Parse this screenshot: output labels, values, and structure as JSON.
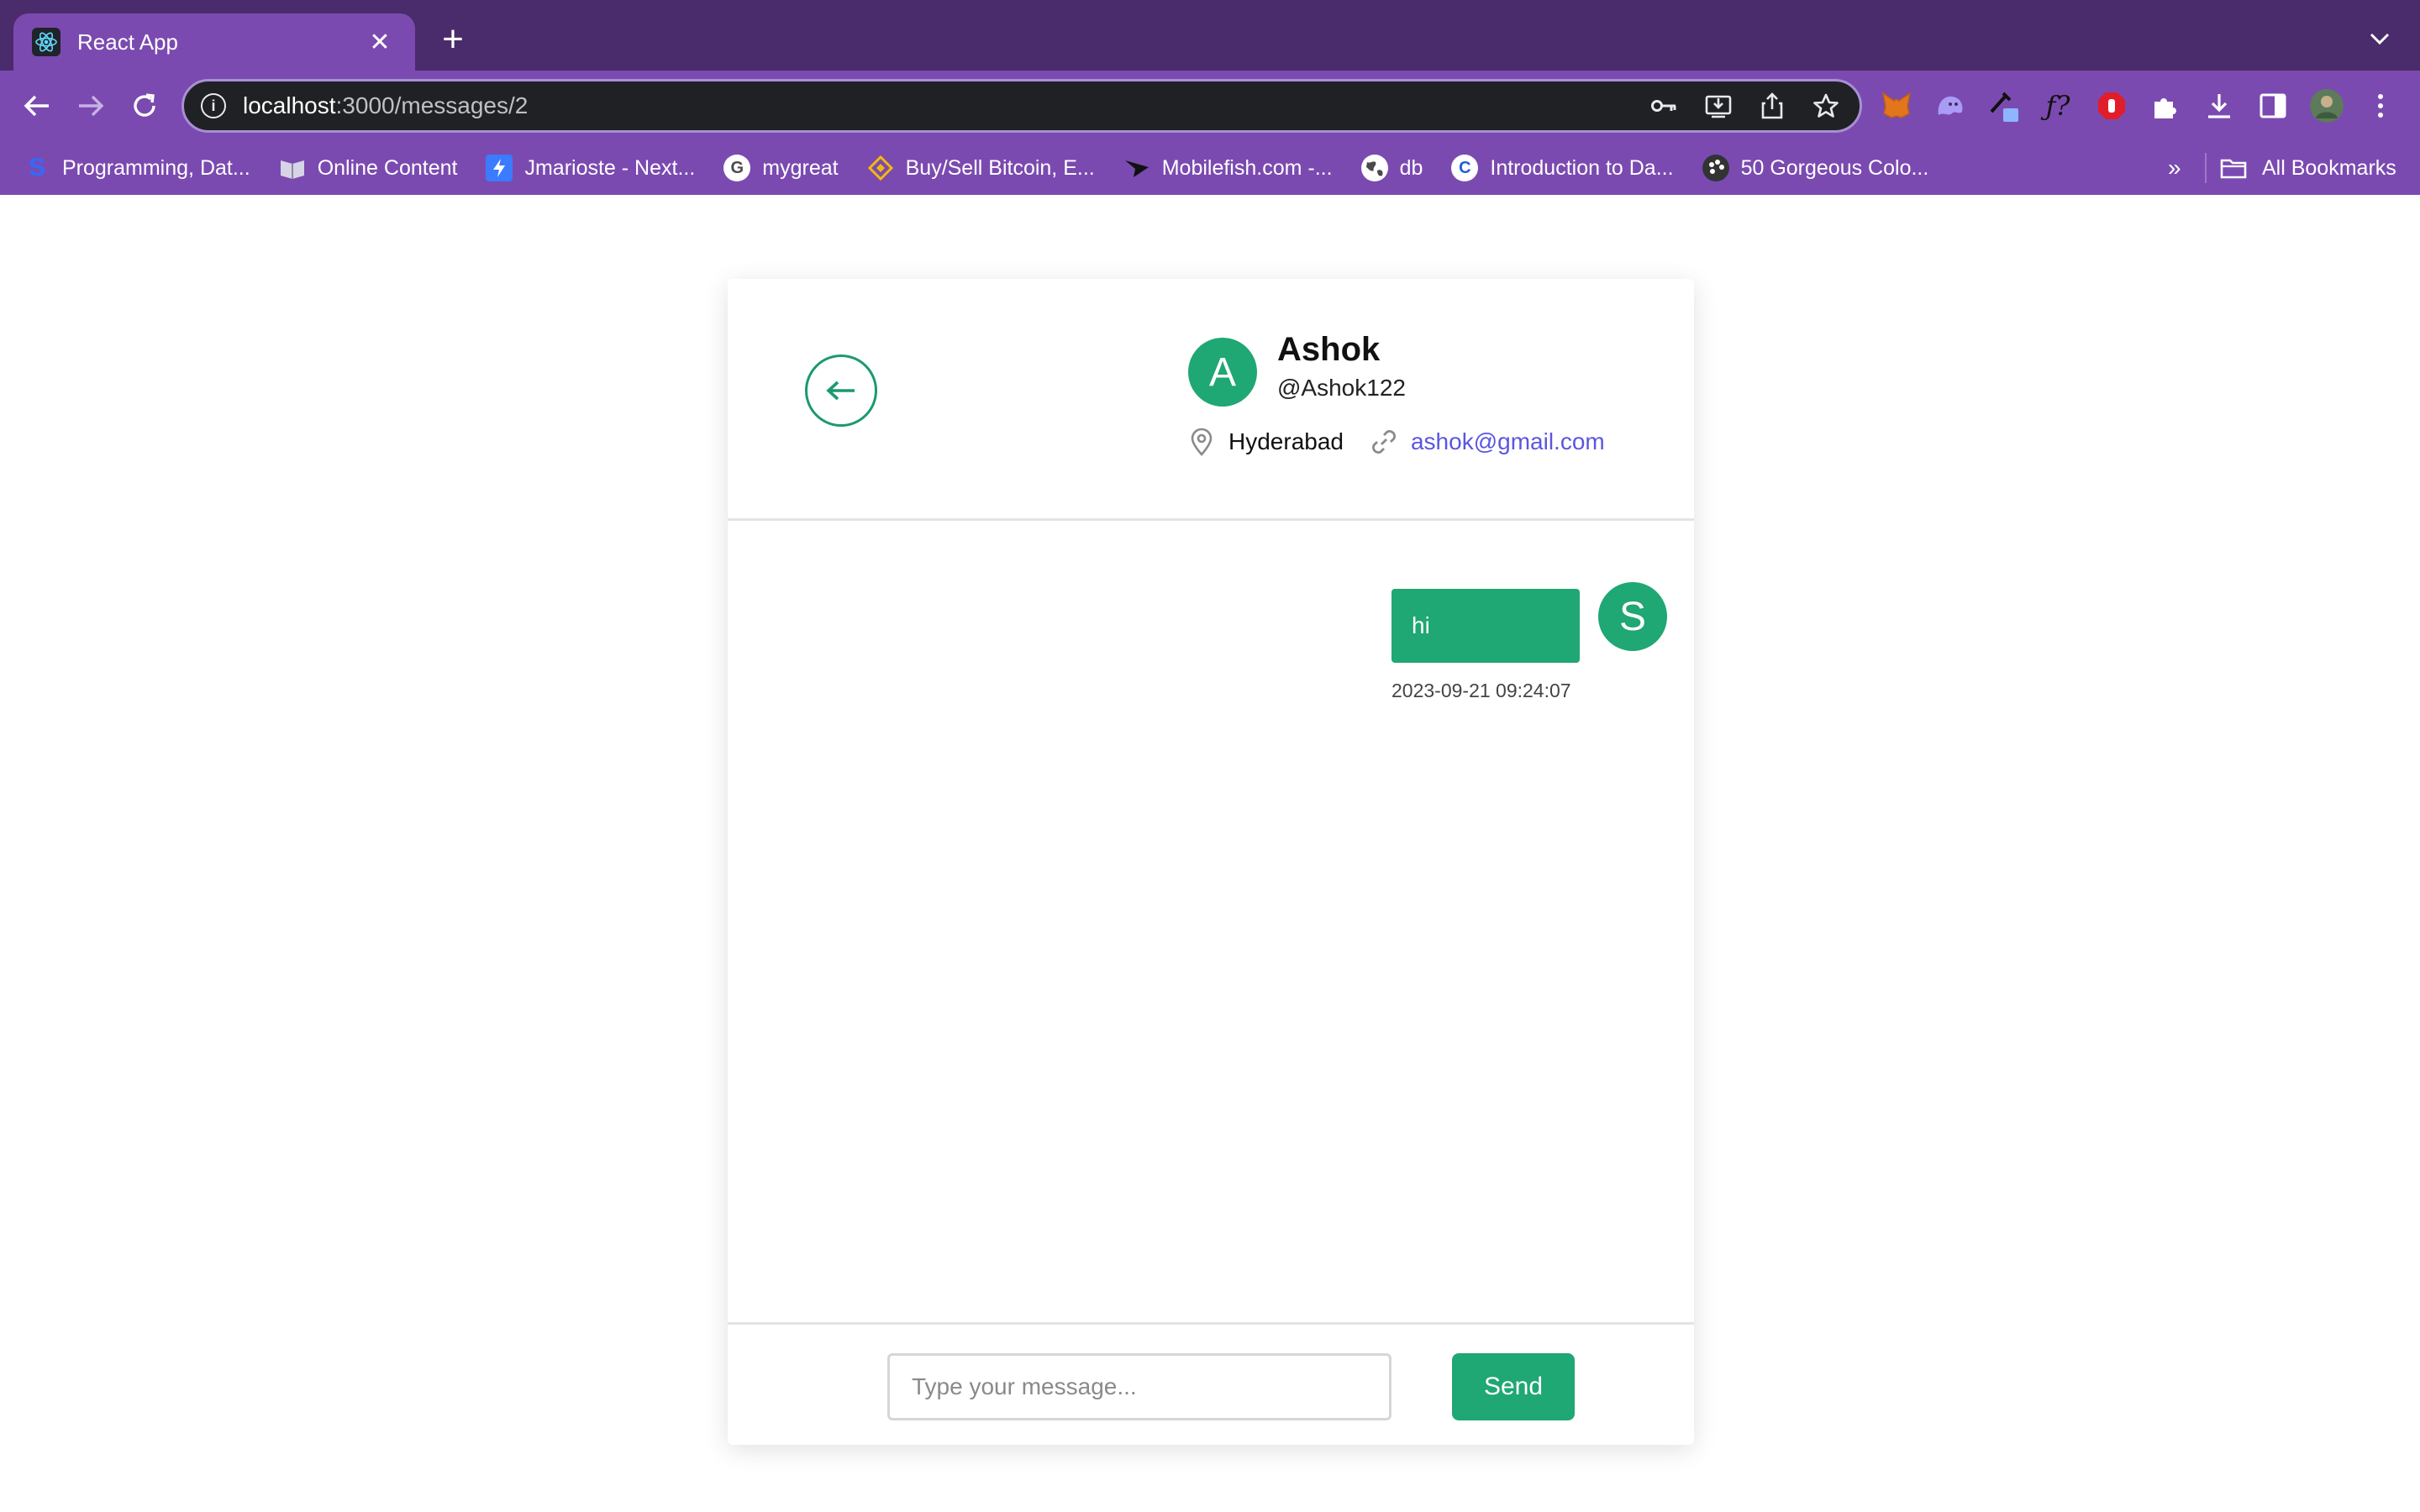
{
  "browser": {
    "tab_title": "React App",
    "tab_close": "✕",
    "new_tab": "+",
    "url_host": "localhost",
    "url_path": ":3000/messages/2",
    "bookmarks": [
      {
        "label": "Programming, Dat...",
        "icon": "s-logo-icon",
        "color": "#2f6bff"
      },
      {
        "label": "Online Content",
        "icon": "book-icon",
        "color": "#c9c9d9"
      },
      {
        "label": "Jmarioste - Next...",
        "icon": "bolt-icon",
        "color": "#3a7bff"
      },
      {
        "label": "mygreat",
        "icon": "google-icon",
        "color": "#ffffff"
      },
      {
        "label": "Buy/Sell Bitcoin, E...",
        "icon": "binance-icon",
        "color": "#f0b90b"
      },
      {
        "label": "Mobilefish.com -...",
        "icon": "fish-icon",
        "color": "#111111"
      },
      {
        "label": "db",
        "icon": "globe-icon",
        "color": "#ffffff"
      },
      {
        "label": "Introduction to Da...",
        "icon": "c-logo-icon",
        "color": "#1f5fd6"
      },
      {
        "label": "50 Gorgeous Colo...",
        "icon": "palette-icon",
        "color": "#333333"
      }
    ],
    "bookmarks_more": "»",
    "all_bookmarks": "All Bookmarks"
  },
  "chat": {
    "contact": {
      "initial": "A",
      "name": "Ashok",
      "handle": "@Ashok122",
      "location": "Hyderabad",
      "email": "ashok@gmail.com"
    },
    "messages": [
      {
        "text": "hi",
        "timestamp": "2023-09-21 09:24:07",
        "sender_initial": "S"
      }
    ],
    "composer": {
      "placeholder": "Type your message...",
      "send_label": "Send"
    }
  },
  "colors": {
    "accent": "#1fa774",
    "chrome": "#7b4ab0",
    "link": "#5b56e0"
  }
}
